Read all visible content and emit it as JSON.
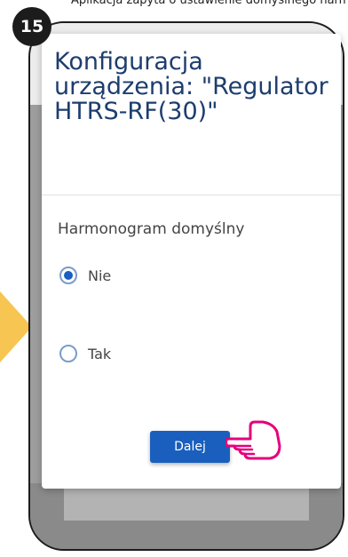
{
  "top_text": "Aplikacja zapyta o ustawienie domyślnego harmonogramu",
  "step_number": "15",
  "dialog": {
    "title": "Konfiguracja urządzenia: \"Regulator HTRS-RF(30)\"",
    "section_label": "Harmonogram domyślny",
    "options": [
      {
        "label": "Nie",
        "selected": true
      },
      {
        "label": "Tak",
        "selected": false
      }
    ],
    "next_button": "Dalej"
  },
  "colors": {
    "accent": "#1a5fbd",
    "title": "#1d3d6d",
    "hand": "#e5007d",
    "arrow": "#f6c552"
  }
}
